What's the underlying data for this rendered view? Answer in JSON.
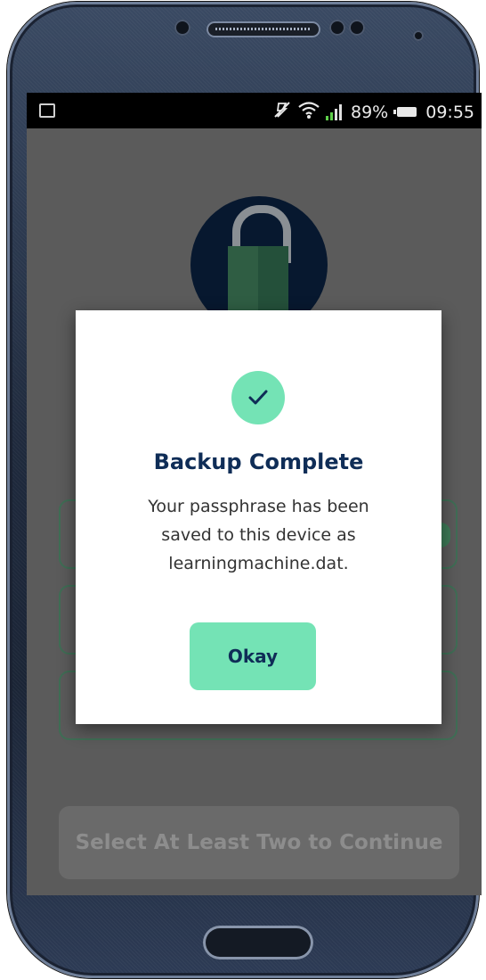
{
  "status_bar": {
    "battery_percent": "89%",
    "time": "09:55",
    "icons": [
      "gallery-icon",
      "mute-icon",
      "wifi-icon",
      "signal-icon",
      "battery-icon"
    ]
  },
  "background": {
    "lock_icon": "padlock-icon",
    "continue_label": "Select At Least Two to Continue"
  },
  "dialog": {
    "icon": "checkmark-icon",
    "title": "Backup Complete",
    "message_lines": [
      "Your passphrase has been",
      "saved to this device as",
      "learningmachine.dat."
    ],
    "ok_label": "Okay"
  },
  "colors": {
    "accent": "#74e3b5",
    "title_navy": "#0f2d57",
    "overlay_gray": "#5b5b5b"
  }
}
